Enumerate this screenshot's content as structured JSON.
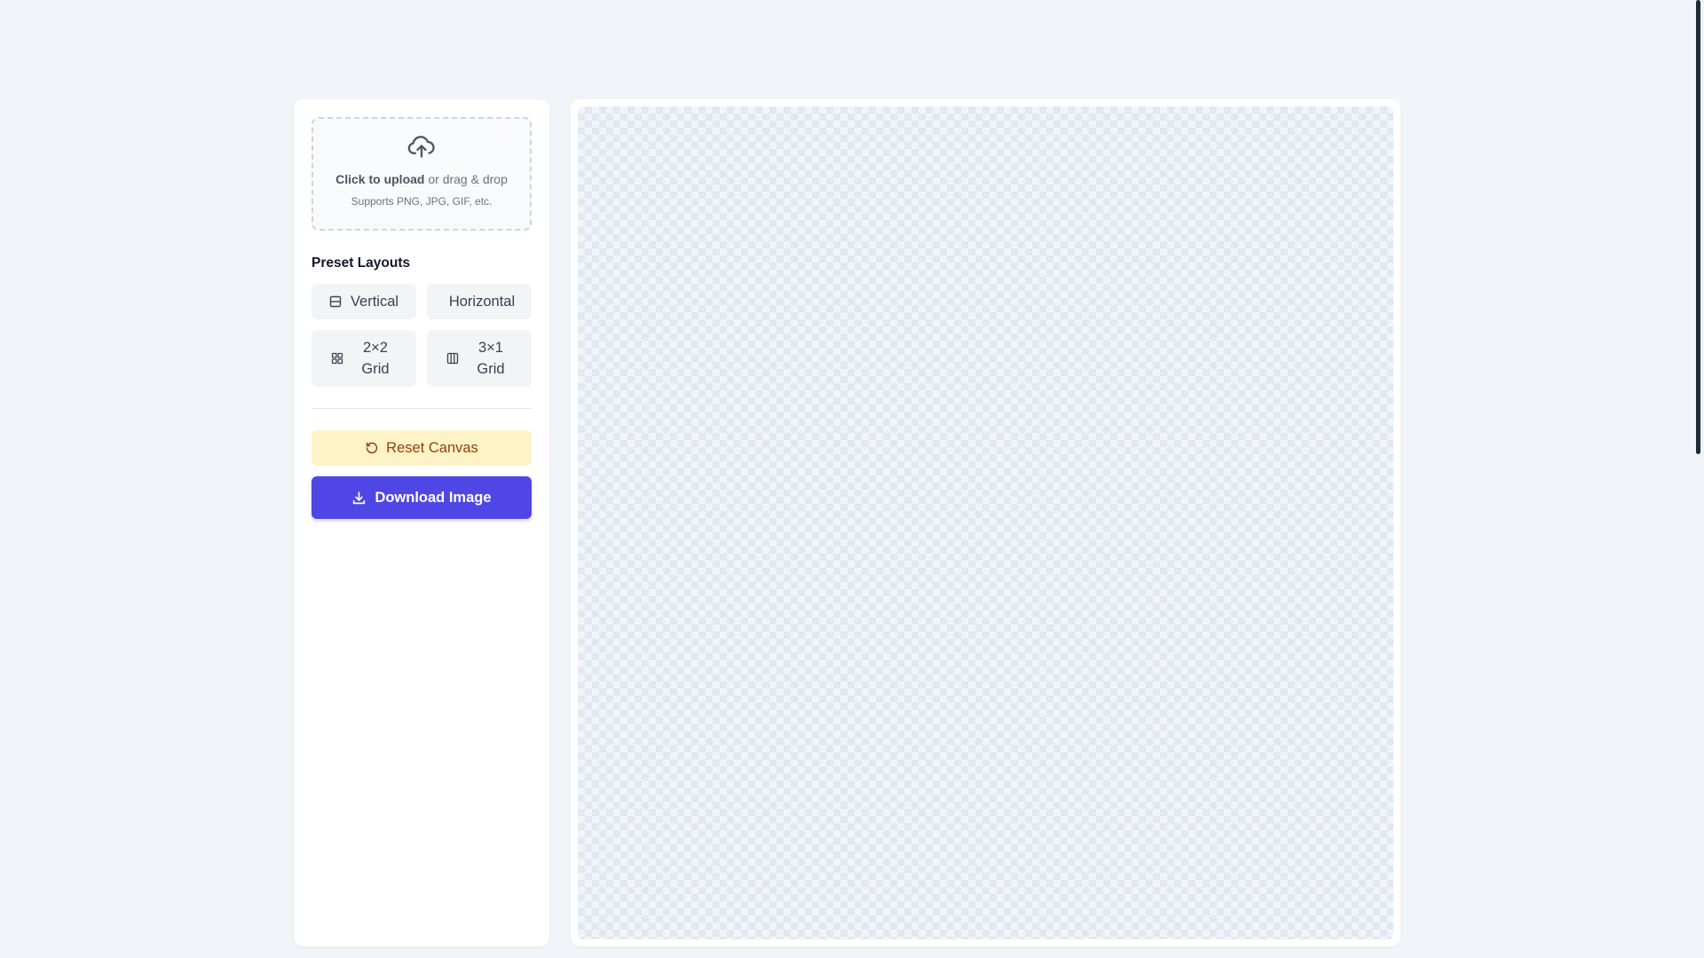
{
  "upload": {
    "cta_bold": "Click to upload",
    "cta_rest": " or drag & drop",
    "hint": "Supports PNG, JPG, GIF, etc.",
    "icon": "cloud-upload-icon"
  },
  "presets": {
    "title": "Preset Layouts",
    "items": [
      {
        "label": "Vertical",
        "icon": "rows-icon"
      },
      {
        "label": "Horizontal",
        "icon": "columns-icon"
      },
      {
        "label": "2×2 Grid",
        "icon": "grid-icon"
      },
      {
        "label": "3×1 Grid",
        "icon": "three-columns-icon"
      }
    ]
  },
  "actions": {
    "reset_label": "Reset Canvas",
    "download_label": "Download Image"
  },
  "colors": {
    "accent": "#4f46e5",
    "reset_bg": "#fef3c7",
    "reset_text": "#92400e",
    "page_bg": "#f1f4f9"
  }
}
